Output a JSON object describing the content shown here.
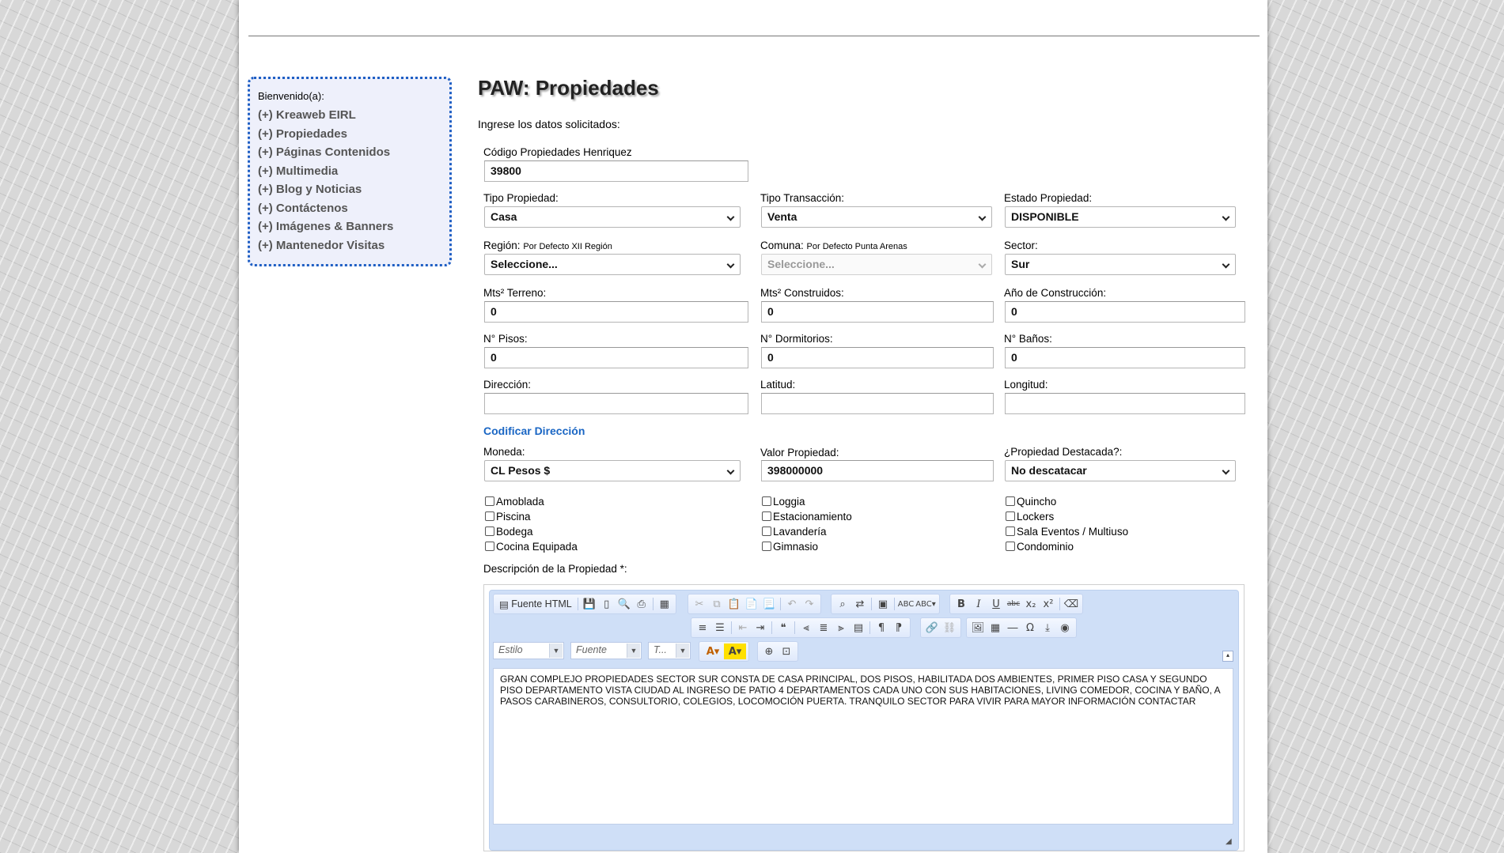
{
  "sidebar": {
    "welcome": "Bienvenido(a):",
    "items": [
      {
        "label": "(+) Kreaweb EIRL"
      },
      {
        "label": "(+) Propiedades"
      },
      {
        "label": "(+) Páginas Contenidos"
      },
      {
        "label": "(+) Multimedia"
      },
      {
        "label": "(+) Blog y Noticias"
      },
      {
        "label": "(+) Contáctenos"
      },
      {
        "label": "(+) Imágenes & Banners"
      },
      {
        "label": "(+) Mantenedor Visitas"
      }
    ]
  },
  "main": {
    "title": "PAW: Propiedades",
    "instructions": "Ingrese los datos solicitados:"
  },
  "form": {
    "codigo": {
      "label": "Código Propiedades Henriquez",
      "value": "39800"
    },
    "tipo_propiedad": {
      "label": "Tipo Propiedad:",
      "value": "Casa"
    },
    "tipo_transaccion": {
      "label": "Tipo Transacción:",
      "value": "Venta"
    },
    "estado_propiedad": {
      "label": "Estado Propiedad:",
      "value": "DISPONIBLE"
    },
    "region": {
      "label": "Región:",
      "hint": "Por Defecto XII Región",
      "value": "Seleccione..."
    },
    "comuna": {
      "label": "Comuna:",
      "hint": "Por Defecto Punta Arenas",
      "value": "Seleccione..."
    },
    "sector": {
      "label": "Sector:",
      "value": "Sur"
    },
    "mts_terreno": {
      "label": "Mts² Terreno:",
      "value": "0"
    },
    "mts_construidos": {
      "label": "Mts² Construidos:",
      "value": "0"
    },
    "anio_construccion": {
      "label": "Año de Construcción:",
      "value": "0"
    },
    "pisos": {
      "label": "N° Pisos:",
      "value": "0"
    },
    "dormitorios": {
      "label": "N° Dormitorios:",
      "value": "0"
    },
    "banos": {
      "label": "N° Baños:",
      "value": "0"
    },
    "direccion": {
      "label": "Dirección:",
      "value": ""
    },
    "latitud": {
      "label": "Latitud:",
      "value": ""
    },
    "longitud": {
      "label": "Longitud:",
      "value": ""
    },
    "geocode_link": "Codificar Dirección",
    "moneda": {
      "label": "Moneda:",
      "value": "CL Pesos $"
    },
    "valor": {
      "label": "Valor Propiedad:",
      "value": "398000000"
    },
    "destacada": {
      "label": "¿Propiedad Destacada?:",
      "value": "No descatacar"
    },
    "amenities": [
      {
        "label": "Amoblada",
        "checked": false
      },
      {
        "label": "Piscina",
        "checked": false
      },
      {
        "label": "Bodega",
        "checked": false
      },
      {
        "label": "Cocina Equipada",
        "checked": false
      },
      {
        "label": "Loggia",
        "checked": false
      },
      {
        "label": "Estacionamiento",
        "checked": false
      },
      {
        "label": "Lavandería",
        "checked": false
      },
      {
        "label": "Gimnasio",
        "checked": false
      },
      {
        "label": "Quincho",
        "checked": false
      },
      {
        "label": "Lockers",
        "checked": false
      },
      {
        "label": "Sala Eventos / Multiuso",
        "checked": false
      },
      {
        "label": "Condominio",
        "checked": false
      }
    ],
    "descripcion_label": "Descripción de la Propiedad *:"
  },
  "editor": {
    "source_label": "Fuente HTML",
    "style_combo": "Estilo",
    "font_combo": "Fuente",
    "size_combo": "T...",
    "content": "GRAN COMPLEJO PROPIEDADES SECTOR SUR CONSTA DE CASA PRINCIPAL, DOS PISOS, HABILITADA DOS AMBIENTES, PRIMER PISO CASA Y SEGUNDO PISO DEPARTAMENTO VISTA CIUDAD AL INGRESO DE PATIO 4 DEPARTAMENTOS CADA UNO CON SUS HABITACIONES, LIVING COMEDOR, COCINA Y BAÑO,  A PASOS CARABINEROS, CONSULTORIO, COLEGIOS,  LOCOMOCIÓN PUERTA.   TRANQUILO SECTOR PARA VIVIR  PARA MAYOR INFORMACIÓN CONTACTAR"
  }
}
